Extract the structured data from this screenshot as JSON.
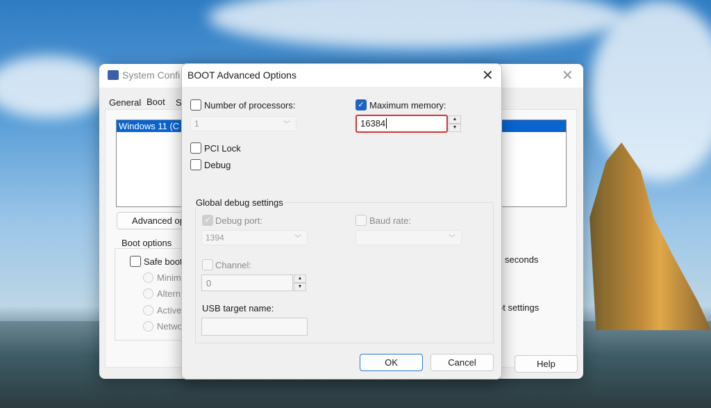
{
  "back_window": {
    "title": "System Confi",
    "tabs": [
      "General",
      "Boot",
      "S"
    ],
    "os_list": [
      "Windows 11 (C"
    ],
    "advanced_button": "Advanced op",
    "boot_options_label": "Boot options",
    "safe_boot": "Safe boot",
    "radios": [
      "Minim",
      "Altern",
      "Active",
      "Netwo"
    ],
    "seconds": "seconds",
    "boot_settings": "ot settings",
    "help": "Help"
  },
  "dialog": {
    "title": "BOOT Advanced Options",
    "num_processors": {
      "label": "Number of processors:",
      "checked": false,
      "value": "1"
    },
    "max_memory": {
      "label": "Maximum memory:",
      "checked": true,
      "value": "16384",
      "highlight_color": "#d13438"
    },
    "pci_lock": {
      "label": "PCI Lock",
      "checked": false
    },
    "debug": {
      "label": "Debug",
      "checked": false
    },
    "global_debug": {
      "label": "Global debug settings",
      "debug_port": {
        "label": "Debug port:",
        "checked": true,
        "value": "1394"
      },
      "baud_rate": {
        "label": "Baud rate:",
        "checked": false,
        "value": ""
      },
      "channel": {
        "label": "Channel:",
        "checked": false,
        "value": "0"
      },
      "usb_target": {
        "label": "USB target name:",
        "value": ""
      }
    },
    "ok": "OK",
    "cancel": "Cancel"
  }
}
